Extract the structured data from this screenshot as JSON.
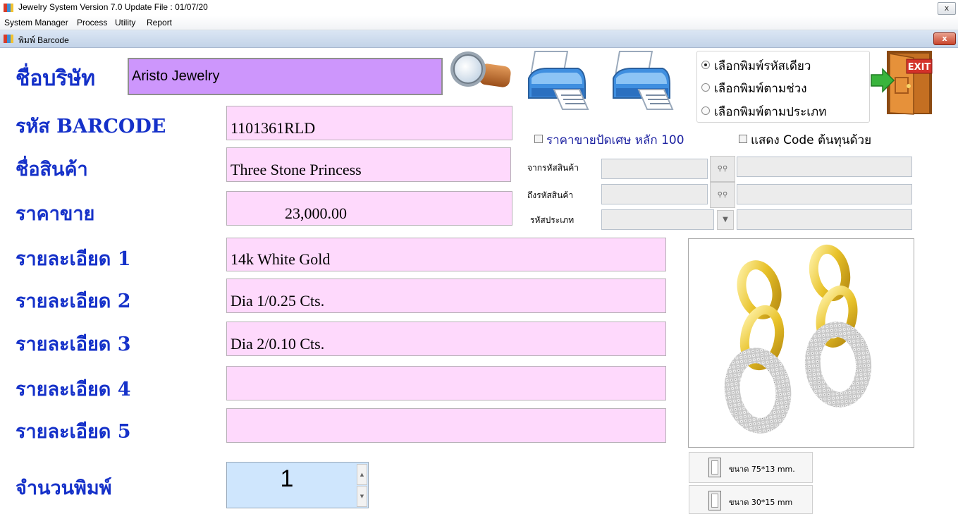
{
  "window": {
    "title": "Jewelry System Version 7.0 Update File : 01/07/20",
    "close_label": "x"
  },
  "menu": [
    "System Manager",
    "Process",
    "Utility",
    "Report"
  ],
  "subwindow": {
    "title": "พิมพ์ Barcode",
    "close_label": "x"
  },
  "labels": {
    "company": "ชื่อบริษัท",
    "barcode": "รหัส BARCODE",
    "product_name": "ชื่อสินค้า",
    "price": "ราคาขาย",
    "detail1": "รายละเอียด 1",
    "detail2": "รายละเอียด 2",
    "detail3": "รายละเอียด 3",
    "detail4": "รายละเอียด 4",
    "detail5": "รายละเอียด 5",
    "print_qty": "จำนวนพิมพ์"
  },
  "values": {
    "company": "Aristo Jewelry",
    "barcode": "1101361RLD",
    "product_name": "Three Stone Princess",
    "price": "23,000.00",
    "detail1": "14k White Gold",
    "detail2": "Dia 1/0.25 Cts.",
    "detail3": "Dia 2/0.10 Cts.",
    "detail4": "",
    "detail5": "",
    "print_qty": "1"
  },
  "radio_options": [
    {
      "label": "เลือกพิมพ์รหัสเดียว",
      "selected": true
    },
    {
      "label": "เลือกพิมพ์ตามช่วง",
      "selected": false
    },
    {
      "label": "เลือกพิมพ์ตามประเภท",
      "selected": false
    }
  ],
  "checkboxes": {
    "round_price": "ราคาขายปัดเศษ หลัก 100",
    "show_cost_code": "แสดง Code ต้นทุนด้วย"
  },
  "filters": {
    "from_product": "จากรหัสสินค้า",
    "to_product": "ถึงรหัสสินค้า",
    "category": "รหัสประเภท"
  },
  "exit_label": "EXIT",
  "size_buttons": [
    "ขนาด  75*13 mm.",
    "ขนาด 30*15 mm"
  ],
  "icons": [
    "search-magnifier-icon",
    "printer-icon",
    "printer-icon",
    "exit-door-icon",
    "binoculars-icon",
    "film-icon"
  ],
  "colors": {
    "label_blue": "#1531c9",
    "field_pink": "#fed9fc",
    "company_purple": "#cd96fc",
    "qty_blue": "#cfe6fd",
    "gold": "#e8c22a"
  }
}
